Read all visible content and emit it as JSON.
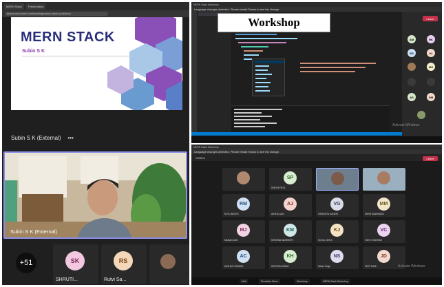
{
  "left": {
    "tabs": [
      "MERN Stack",
      "Presentation"
    ],
    "url": "teams.microsoft.com/meeting/merm-stack-workshop",
    "slide": {
      "title": "MERN STACK",
      "subtitle": "Subin S K"
    },
    "presenter": {
      "label": "Subin S K (External)",
      "more": "•••"
    },
    "video": {
      "name": "Subin S K (External)"
    },
    "overflow": "+51",
    "participants": [
      {
        "initials": "SK",
        "name": "SHRUTI...",
        "color": "#f2c7e0",
        "text_color": "#7a2a56"
      },
      {
        "initials": "RS",
        "name": "Rutvi Sa...",
        "color": "#f3d7b8",
        "text_color": "#7a4a16"
      }
    ]
  },
  "right_top": {
    "title": "MERN Stack Workshop",
    "notice": "Language changes detected. Please restart Teams to see the change.",
    "overlay_label": "Workshop",
    "leave": "Leave",
    "watermark": "Activate Windows",
    "side_participants": [
      {
        "initials": "AM",
        "color": "#d7e6c9"
      },
      {
        "initials": "RK",
        "color": "#e8d0f0"
      },
      {
        "initials": "SG",
        "color": "#c9e0f3"
      },
      {
        "initials": "KI",
        "color": "#f3d9c9"
      },
      {
        "initials": "MG",
        "color": "#f3f0c9"
      },
      {
        "initials": "AS",
        "color": "#d7e6c9"
      },
      {
        "initials": "GM",
        "color": "#f3d9c9"
      }
    ]
  },
  "right_bottom": {
    "title": "MERN Stack Workshop",
    "notice": "Language changes detected. Please restart Teams to see the change.",
    "toolbar": "SUBHA",
    "leave": "Leave",
    "watermark": "Activate Windows",
    "tiles": [
      {
        "initials": "SP",
        "name": "SHRIYA PATIL",
        "color": "#d7ecd0"
      },
      {
        "initials": "RM",
        "name": "RUTU MISTRI",
        "color": "#cfe1f3"
      },
      {
        "initials": "AJ",
        "name": "AKSHA JAIN",
        "color": "#f3d4cf"
      },
      {
        "initials": "VG",
        "name": "VIRADHYA GANDHI",
        "color": "#d9dde8"
      },
      {
        "initials": "MM",
        "name": "MIHIR MADHWANI",
        "color": "#f1e6c9"
      },
      {
        "initials": "MJ",
        "name": "MANAN JAIN",
        "color": "#f2d3e4"
      },
      {
        "initials": "KM",
        "name": "KRISHNA MAHESHRI",
        "color": "#cfe8e6"
      },
      {
        "initials": "KJ",
        "name": "KOYAL JOSHI",
        "color": "#f4e3c4"
      },
      {
        "initials": "VC",
        "name": "VIDHI CHAVHAN",
        "color": "#ecd4f1"
      },
      {
        "initials": "AC",
        "name": "AKSHAT CHAWDA",
        "color": "#cfe1f3"
      },
      {
        "initials": "KH",
        "name": "KRUTIKA HIRANI",
        "color": "#d6eccf"
      },
      {
        "initials": "NS",
        "name": "Nitesh Singh",
        "color": "#dcdcec"
      },
      {
        "initials": "JD",
        "name": "JEET DAVE",
        "color": "#f3d9cf"
      }
    ],
    "taskbar": [
      "Mail",
      "Shraddha Mune",
      "Workshop",
      "MERN Stack Workshop"
    ]
  }
}
